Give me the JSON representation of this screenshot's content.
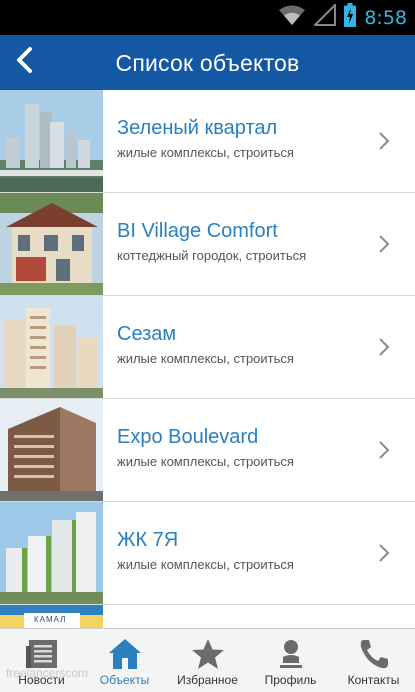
{
  "status_bar": {
    "time": "8:58",
    "icons": [
      "wifi-icon",
      "signal-icon",
      "battery-charging-icon"
    ]
  },
  "action_bar": {
    "title": "Список объектов",
    "back_icon": "chevron-left-icon"
  },
  "colors": {
    "action_bar": "#1457a3",
    "accent": "#2a7fc1",
    "status_time": "#33b5e5"
  },
  "objects": [
    {
      "name": "Зеленый квартал",
      "subtitle": "жилые комплексы, строиться"
    },
    {
      "name": "BI Village Comfort",
      "subtitle": "коттеджный городок, строиться"
    },
    {
      "name": "Сезам",
      "subtitle": "жилые комплексы, строиться"
    },
    {
      "name": "Expo Boulevard",
      "subtitle": "жилые комплексы, строиться"
    },
    {
      "name": "ЖК 7Я",
      "subtitle": "жилые комплексы, строиться"
    }
  ],
  "partial_row_logo": "КАМАЛ",
  "tabs": [
    {
      "label": "Новости",
      "icon": "news-icon",
      "active": false
    },
    {
      "label": "Объекты",
      "icon": "home-icon",
      "active": true
    },
    {
      "label": "Избранное",
      "icon": "star-icon",
      "active": false
    },
    {
      "label": "Профиль",
      "icon": "person-icon",
      "active": false
    },
    {
      "label": "Контакты",
      "icon": "phone-icon",
      "active": false
    }
  ],
  "watermark": "freelancerscom"
}
